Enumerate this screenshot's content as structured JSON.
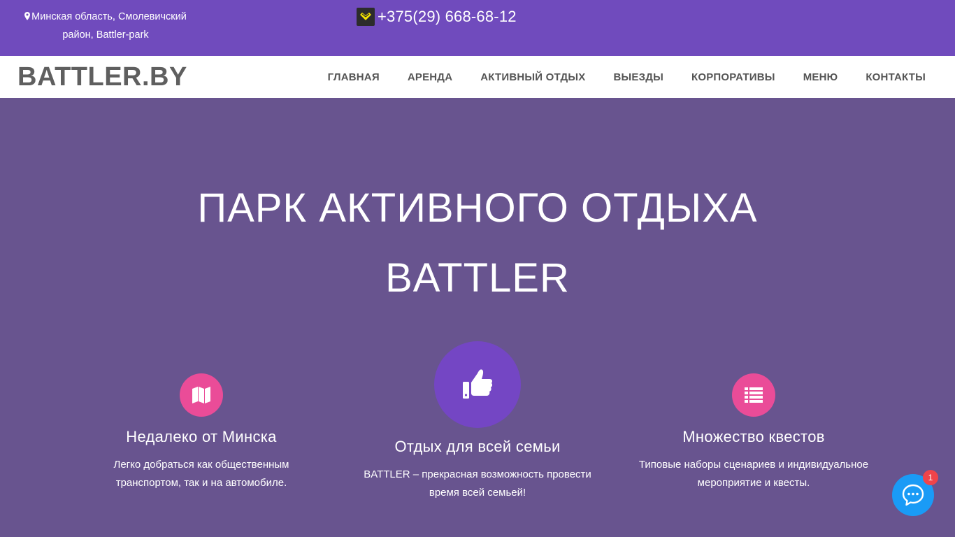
{
  "topbar": {
    "address_line1": "Минская область, Смолевичский",
    "address_line2": "район, Battler-park",
    "phone": "+375(29) 668-68-12"
  },
  "navbar": {
    "logo": "BATTLER.BY",
    "menu": [
      "ГЛАВНАЯ",
      "АРЕНДА",
      "АКТИВНЫЙ ОТДЫХ",
      "ВЫЕЗДЫ",
      "КОРПОРАТИВЫ",
      "МЕНЮ",
      "КОНТАКТЫ"
    ]
  },
  "hero": {
    "title_line1": "ПАРК АКТИВНОГО ОТДЫХА",
    "title_line2": "BATTLER"
  },
  "features": [
    {
      "icon": "map-icon",
      "title": "Недалеко от Минска",
      "text_line1": "Легко добраться как общественным",
      "text_line2": "транспортом, так и на автомобиле."
    },
    {
      "icon": "thumbs-up-icon",
      "title": "Отдых для всей семьи",
      "text_line1": "BATTLER – прекрасная возможность провести",
      "text_line2": "время всей семьей!"
    },
    {
      "icon": "list-icon",
      "title": "Множество квестов",
      "text_line1": "Типовые наборы сценариев и индивидуальное",
      "text_line2": "мероприятие и квесты."
    }
  ],
  "chat": {
    "icon": "chat-icon",
    "badge_count": "1"
  },
  "colors": {
    "topbar": "#704bbd",
    "hero_bg": "#68548f",
    "accent_pink": "#ea4c98",
    "accent_purple": "#7446c4",
    "chat_blue": "#1a9bf6",
    "badge_red": "#f0444a"
  }
}
